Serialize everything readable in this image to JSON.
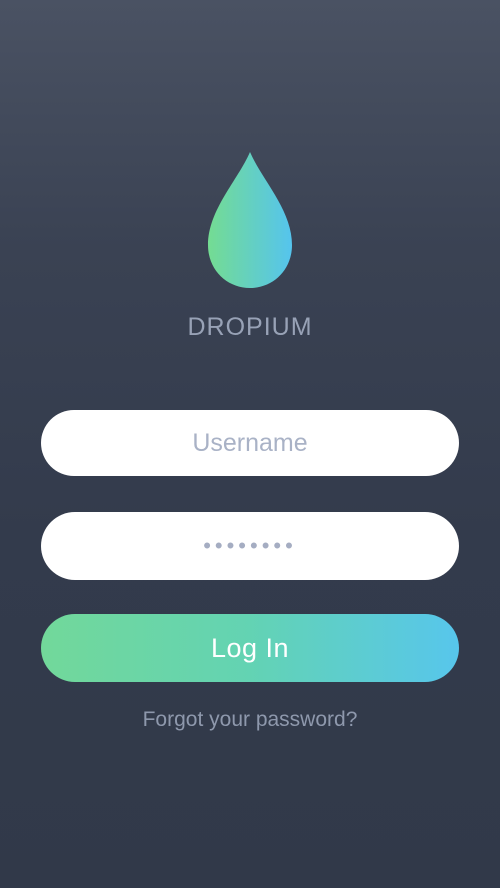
{
  "app": {
    "brand_name": "DROPIUM",
    "logo_icon": "water-drop-icon",
    "logo_gradient": [
      "#74dc92",
      "#55c4ee"
    ]
  },
  "login_form": {
    "username": {
      "placeholder": "Username",
      "value": ""
    },
    "password": {
      "value": "••••••••",
      "masked_length": 8
    },
    "submit_label": "Log In",
    "forgot_password_label": "Forgot your password?"
  },
  "colors": {
    "background_top": "#4a5263",
    "background_bottom": "#313949",
    "brand_text": "#98a2b6",
    "placeholder_text": "#a9b2c6",
    "button_gradient_start": "#72d89a",
    "button_gradient_end": "#57c6ec",
    "link_text": "#8e98ac"
  }
}
